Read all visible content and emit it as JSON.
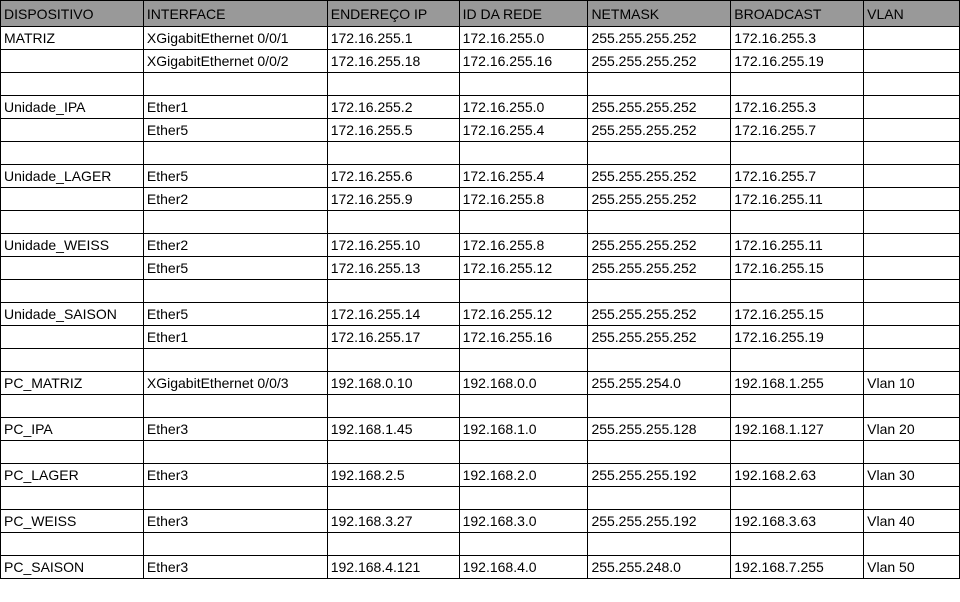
{
  "table": {
    "headers": [
      "DISPOSITIVO",
      "INTERFACE",
      "ENDEREÇO IP",
      "ID DA REDE",
      "NETMASK",
      "BROADCAST",
      "VLAN"
    ],
    "rows": [
      [
        "MATRIZ",
        "XGigabitEthernet 0/0/1",
        "172.16.255.1",
        "172.16.255.0",
        "255.255.255.252",
        "172.16.255.3",
        ""
      ],
      [
        "",
        "XGigabitEthernet 0/0/2",
        "172.16.255.18",
        "172.16.255.16",
        "255.255.255.252",
        "172.16.255.19",
        ""
      ],
      [
        "",
        "",
        "",
        "",
        "",
        "",
        ""
      ],
      [
        "Unidade_IPA",
        "Ether1",
        "172.16.255.2",
        "172.16.255.0",
        "255.255.255.252",
        "172.16.255.3",
        ""
      ],
      [
        "",
        "Ether5",
        "172.16.255.5",
        "172.16.255.4",
        "255.255.255.252",
        "172.16.255.7",
        ""
      ],
      [
        "",
        "",
        "",
        "",
        "",
        "",
        ""
      ],
      [
        "Unidade_LAGER",
        "Ether5",
        "172.16.255.6",
        "172.16.255.4",
        "255.255.255.252",
        "172.16.255.7",
        ""
      ],
      [
        "",
        "Ether2",
        "172.16.255.9",
        "172.16.255.8",
        "255.255.255.252",
        "172.16.255.11",
        ""
      ],
      [
        "",
        "",
        "",
        "",
        "",
        "",
        ""
      ],
      [
        "Unidade_WEISS",
        "Ether2",
        "172.16.255.10",
        "172.16.255.8",
        "255.255.255.252",
        "172.16.255.11",
        ""
      ],
      [
        "",
        "Ether5",
        "172.16.255.13",
        "172.16.255.12",
        "255.255.255.252",
        "172.16.255.15",
        ""
      ],
      [
        "",
        "",
        "",
        "",
        "",
        "",
        ""
      ],
      [
        "Unidade_SAISON",
        "Ether5",
        "172.16.255.14",
        "172.16.255.12",
        "255.255.255.252",
        "172.16.255.15",
        ""
      ],
      [
        "",
        "Ether1",
        "172.16.255.17",
        "172.16.255.16",
        "255.255.255.252",
        "172.16.255.19",
        ""
      ],
      [
        "",
        "",
        "",
        "",
        "",
        "",
        ""
      ],
      [
        "PC_MATRIZ",
        "XGigabitEthernet 0/0/3",
        "192.168.0.10",
        "192.168.0.0",
        "255.255.254.0",
        "192.168.1.255",
        "Vlan 10"
      ],
      [
        "",
        "",
        "",
        "",
        "",
        "",
        ""
      ],
      [
        "PC_IPA",
        "Ether3",
        "192.168.1.45",
        "192.168.1.0",
        "255.255.255.128",
        "192.168.1.127",
        "Vlan 20"
      ],
      [
        "",
        "",
        "",
        "",
        "",
        "",
        ""
      ],
      [
        "PC_LAGER",
        "Ether3",
        "192.168.2.5",
        "192.168.2.0",
        "255.255.255.192",
        "192.168.2.63",
        "Vlan 30"
      ],
      [
        "",
        "",
        "",
        "",
        "",
        "",
        ""
      ],
      [
        "PC_WEISS",
        "Ether3",
        "192.168.3.27",
        "192.168.3.0",
        "255.255.255.192",
        "192.168.3.63",
        "Vlan 40"
      ],
      [
        "",
        "",
        "",
        "",
        "",
        "",
        ""
      ],
      [
        "PC_SAISON",
        "Ether3",
        "192.168.4.121",
        "192.168.4.0",
        "255.255.248.0",
        "192.168.7.255",
        "Vlan 50"
      ]
    ]
  },
  "colors": {
    "header_bg": "#999999",
    "grid": "#000000",
    "cell_bg": "#ffffff"
  }
}
